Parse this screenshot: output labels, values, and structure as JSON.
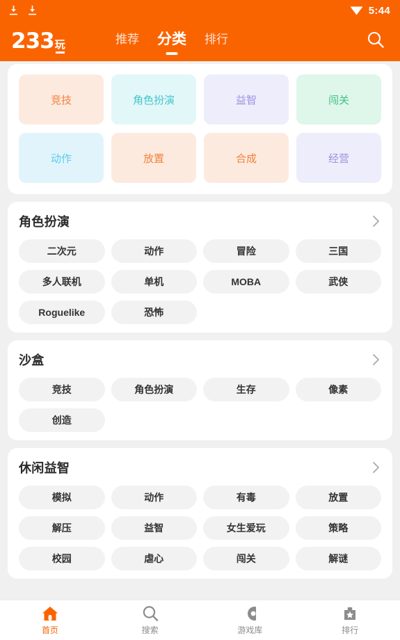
{
  "theme": {
    "brand_orange": "#FA6400",
    "page_bg": "#F0F0F0",
    "card_bg": "#FFFFFF",
    "chip_bg": "#F2F2F2",
    "chip_text": "#333333",
    "inactive_nav": "#8C8C8C"
  },
  "statusbar": {
    "download_icon_1": "download-icon",
    "download_icon_2": "download-icon",
    "wifi_icon": "wifi-icon",
    "time": "5:44"
  },
  "header": {
    "logo_main": "233",
    "logo_sub": "玩",
    "search_icon": "search-icon",
    "tabs": [
      {
        "label": "推荐",
        "active": false
      },
      {
        "label": "分类",
        "active": true
      },
      {
        "label": "排行",
        "active": false
      }
    ]
  },
  "quick_tiles": [
    {
      "label": "竞技",
      "bg": "#FDEADF",
      "color": "#F0823C"
    },
    {
      "label": "角色扮演",
      "bg": "#E2F7F8",
      "color": "#46C5CE"
    },
    {
      "label": "益智",
      "bg": "#EEEDFB",
      "color": "#9A93E0"
    },
    {
      "label": "闯关",
      "bg": "#DFF6EA",
      "color": "#3FC286"
    },
    {
      "label": "动作",
      "bg": "#E2F4FB",
      "color": "#5BCBEC"
    },
    {
      "label": "放置",
      "bg": "#FDEADF",
      "color": "#F0823C"
    },
    {
      "label": "合成",
      "bg": "#FDEADF",
      "color": "#F0823C"
    },
    {
      "label": "经营",
      "bg": "#EEEDFB",
      "color": "#9A93E0"
    }
  ],
  "sections": [
    {
      "title": "角色扮演",
      "chevron_icon": "chevron-right-icon",
      "chips": [
        "二次元",
        "动作",
        "冒险",
        "三国",
        "多人联机",
        "单机",
        "MOBA",
        "武侠",
        "Roguelike",
        "恐怖"
      ]
    },
    {
      "title": "沙盒",
      "chevron_icon": "chevron-right-icon",
      "chips": [
        "竞技",
        "角色扮演",
        "生存",
        "像素",
        "创造"
      ]
    },
    {
      "title": "休闲益智",
      "chevron_icon": "chevron-right-icon",
      "chips": [
        "模拟",
        "动作",
        "有毒",
        "放置",
        "解压",
        "益智",
        "女生爱玩",
        "策略",
        "校园",
        "虐心",
        "闯关",
        "解谜"
      ]
    }
  ],
  "bottom_nav": [
    {
      "label": "首页",
      "icon": "home-icon",
      "active": true
    },
    {
      "label": "搜索",
      "icon": "search-icon",
      "active": false
    },
    {
      "label": "游戏库",
      "icon": "gamepad-icon",
      "active": false
    },
    {
      "label": "排行",
      "icon": "trophy-icon",
      "active": false
    }
  ]
}
